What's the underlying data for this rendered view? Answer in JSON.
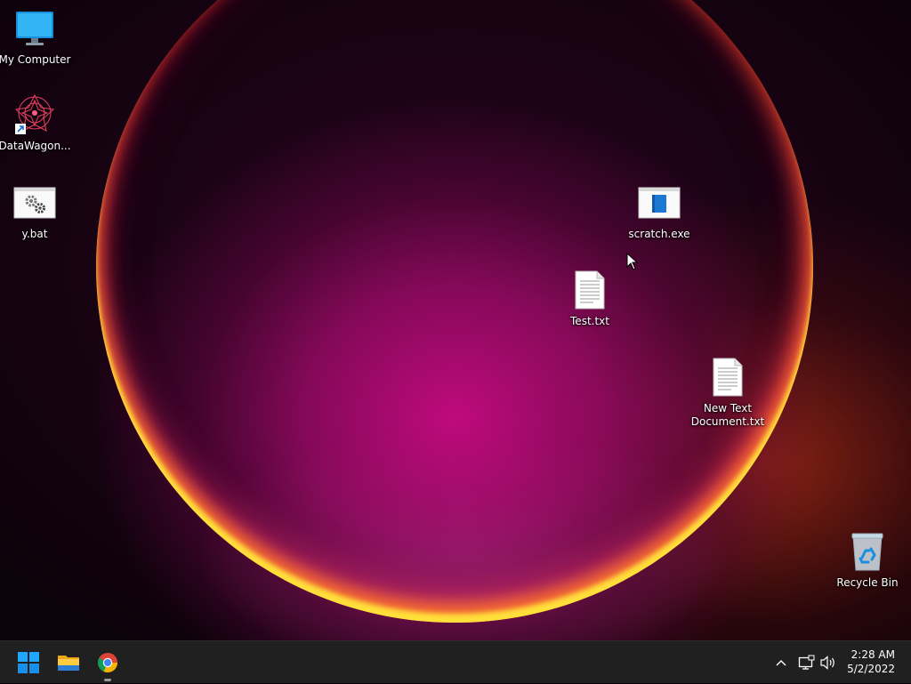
{
  "desktop": {
    "icons": [
      {
        "label": "My Computer",
        "icon": "monitor-icon"
      },
      {
        "label": "DataWagon...",
        "icon": "datawagon-shortcut-icon"
      },
      {
        "label": "y.bat",
        "icon": "batch-file-icon"
      },
      {
        "label": "scratch.exe",
        "icon": "exe-file-icon"
      },
      {
        "label": "Test.txt",
        "icon": "text-file-icon"
      },
      {
        "label": "New Text Document.txt",
        "icon": "text-file-icon"
      },
      {
        "label": "Recycle Bin",
        "icon": "recycle-bin-icon"
      }
    ]
  },
  "taskbar": {
    "pinned": [
      {
        "name": "Start",
        "icon": "windows-start-icon"
      },
      {
        "name": "File Explorer",
        "icon": "folder-icon"
      },
      {
        "name": "Google Chrome",
        "icon": "chrome-icon"
      }
    ],
    "tray": {
      "icons": [
        "chevron-up-icon",
        "network-icon",
        "volume-icon"
      ]
    },
    "clock": {
      "time": "2:28 AM",
      "date": "5/2/2022"
    }
  },
  "colors": {
    "taskbar_bg": "#202020",
    "accent_blue": "#0078d4",
    "wallpaper_magenta": "#c0107f"
  }
}
